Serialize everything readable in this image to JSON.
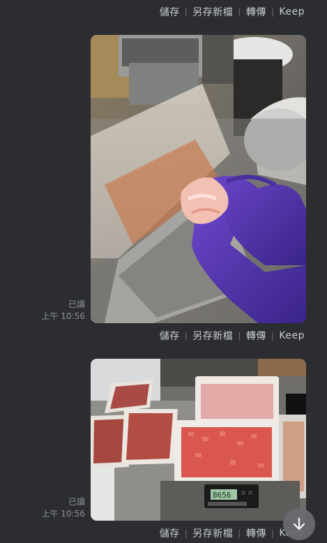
{
  "messages": [
    {
      "read_label": "已讀",
      "time": "上午 10:56",
      "actions": {
        "save": "儲存",
        "save_as": "另存新檔",
        "forward": "轉傳",
        "keep": "Keep"
      }
    },
    {
      "read_label": "已讀",
      "time": "上午 10:56",
      "actions": {
        "save": "儲存",
        "save_as": "另存新檔",
        "forward": "轉傳",
        "keep": "Keep"
      }
    }
  ],
  "top_actions": {
    "save": "儲存",
    "save_as": "另存新檔",
    "forward": "轉傳",
    "keep": "Keep"
  },
  "scale_reading": "8656",
  "icons": {
    "scroll_down": "arrow-down-icon"
  }
}
